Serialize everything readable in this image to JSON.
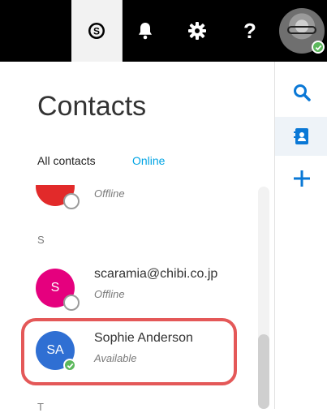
{
  "top_bar": {
    "skype_icon": "skype-icon",
    "bell_icon": "bell-icon",
    "gear_icon": "gear-icon",
    "help_icon": "help-icon",
    "help_label": "?",
    "avatar": "user-avatar",
    "status_color": "#5cb85c"
  },
  "sidebar": {
    "search_icon": "search-icon",
    "contacts_icon": "contacts-icon",
    "add_icon": "add-icon"
  },
  "page": {
    "title": "Contacts",
    "tabs": [
      {
        "label": "All contacts",
        "active": true
      },
      {
        "label": "Online",
        "active": false
      }
    ]
  },
  "contacts": {
    "top_partial": {
      "status": "Offline",
      "avatar_color": "#e22a2a"
    },
    "section_s": "S",
    "items": [
      {
        "initials": "S",
        "name": "scaramia@chibi.co.jp",
        "status": "Offline",
        "avatar_color": "#e5007e"
      },
      {
        "initials": "SA",
        "name": "Sophie Anderson",
        "status": "Available",
        "avatar_color": "#2f6fd3",
        "presence_color": "#5cb85c"
      }
    ],
    "section_t": "T"
  }
}
